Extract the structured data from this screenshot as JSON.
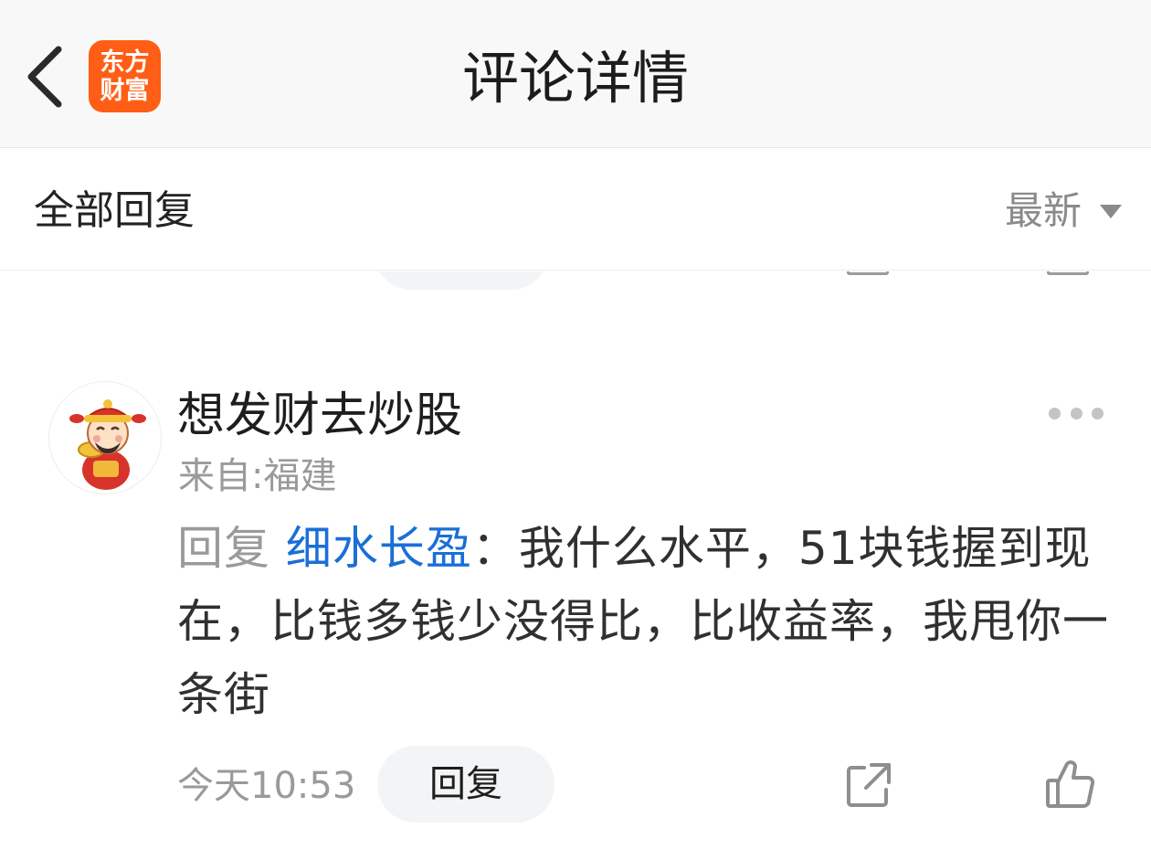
{
  "navbar": {
    "title": "评论详情",
    "logo_line1": "东方",
    "logo_line2": "财富",
    "logo_color": "#ff5e16"
  },
  "sortbar": {
    "all_replies": "全部回复",
    "sort_selected": "最新"
  },
  "comment": {
    "username": "想发财去炒股",
    "location": "来自:福建",
    "reply_prefix": "回复",
    "reply_target": "细水长盈",
    "separator": "：",
    "text": "我什么水平，51块钱握到现在，比钱多钱少没得比，比收益率，我甩你一条街",
    "timestamp": "今天10:53",
    "reply_button": "回复",
    "link_color": "#1a6fd6"
  },
  "icons": {
    "back": "chevron-left-icon",
    "more": "more-dots-icon",
    "share": "share-icon",
    "like": "thumbs-up-icon"
  }
}
